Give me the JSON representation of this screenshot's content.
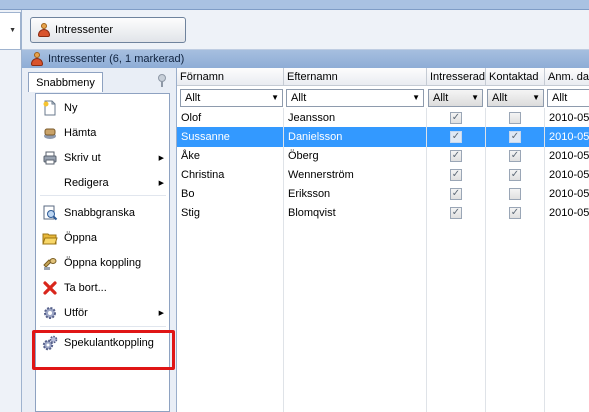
{
  "toolbar": {
    "tab_label": "Intressenter"
  },
  "window": {
    "title": "Intressenter (6, 1 markerad)"
  },
  "sidebar": {
    "tab_label": "Snabbmeny",
    "items": [
      {
        "label": "Ny",
        "icon": "new-document-icon",
        "submenu": false
      },
      {
        "label": "Hämta",
        "icon": "fetch-icon",
        "submenu": false
      },
      {
        "label": "Skriv ut",
        "icon": "printer-icon",
        "submenu": true
      },
      {
        "label": "Redigera",
        "icon": "",
        "submenu": true
      },
      {
        "label": "Snabbgranska",
        "icon": "preview-icon",
        "submenu": false
      },
      {
        "label": "Öppna",
        "icon": "folder-open-icon",
        "submenu": false
      },
      {
        "label": "Öppna koppling",
        "icon": "open-link-icon",
        "submenu": false
      },
      {
        "label": "Ta bort...",
        "icon": "delete-icon",
        "submenu": false
      },
      {
        "label": "Utför",
        "icon": "gear-icon",
        "submenu": true
      },
      {
        "label": "Spekulantkoppling",
        "icon": "gears-icon",
        "submenu": false
      }
    ]
  },
  "grid": {
    "columns": [
      "Förnamn",
      "Efternamn",
      "Intresserad",
      "Kontaktad",
      "Anm. dag"
    ],
    "filters": [
      "Allt",
      "Allt",
      "Allt",
      "Allt",
      "Allt"
    ],
    "rows": [
      {
        "fornamn": "Olof",
        "efternamn": "Jeansson",
        "intresserad": true,
        "kontaktad": false,
        "anm": "2010-05",
        "selected": false
      },
      {
        "fornamn": "Sussanne",
        "efternamn": "Danielsson",
        "intresserad": true,
        "kontaktad": true,
        "anm": "2010-05",
        "selected": true
      },
      {
        "fornamn": "Åke",
        "efternamn": "Öberg",
        "intresserad": true,
        "kontaktad": true,
        "anm": "2010-05",
        "selected": false
      },
      {
        "fornamn": "Christina",
        "efternamn": "Wennerström",
        "intresserad": true,
        "kontaktad": true,
        "anm": "2010-05",
        "selected": false
      },
      {
        "fornamn": "Bo",
        "efternamn": "Eriksson",
        "intresserad": true,
        "kontaktad": false,
        "anm": "2010-05",
        "selected": false
      },
      {
        "fornamn": "Stig",
        "efternamn": "Blomqvist",
        "intresserad": true,
        "kontaktad": true,
        "anm": "2010-05",
        "selected": false
      }
    ]
  },
  "colors": {
    "selection": "#3399ff",
    "highlight_box": "#e01616"
  }
}
